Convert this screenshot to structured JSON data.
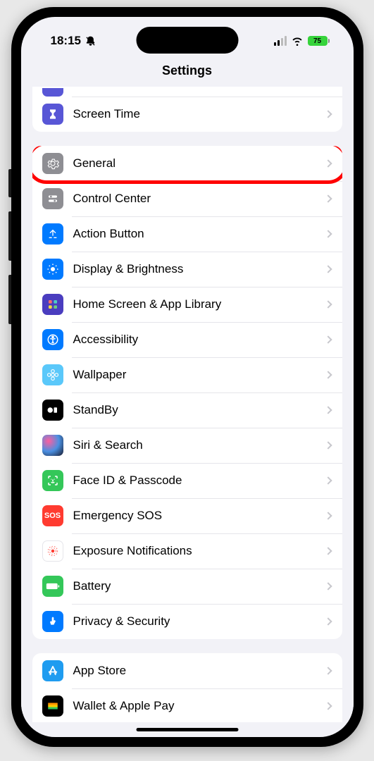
{
  "status": {
    "time": "18:15",
    "battery": "75"
  },
  "header": {
    "title": "Settings"
  },
  "group0": {
    "item0": {
      "label": ""
    },
    "item1": {
      "label": "Screen Time"
    }
  },
  "group1": {
    "item0": {
      "label": "General"
    },
    "item1": {
      "label": "Control Center"
    },
    "item2": {
      "label": "Action Button"
    },
    "item3": {
      "label": "Display & Brightness"
    },
    "item4": {
      "label": "Home Screen & App Library"
    },
    "item5": {
      "label": "Accessibility"
    },
    "item6": {
      "label": "Wallpaper"
    },
    "item7": {
      "label": "StandBy"
    },
    "item8": {
      "label": "Siri & Search"
    },
    "item9": {
      "label": "Face ID & Passcode"
    },
    "item10": {
      "label": "Emergency SOS"
    },
    "item11": {
      "label": "Exposure Notifications"
    },
    "item12": {
      "label": "Battery"
    },
    "item13": {
      "label": "Privacy & Security"
    }
  },
  "group2": {
    "item0": {
      "label": "App Store"
    },
    "item1": {
      "label": "Wallet & Apple Pay"
    }
  },
  "colors": {
    "purple": "#5856d6",
    "gray": "#8e8e93",
    "blue": "#007aff",
    "blue2": "#1b95e0",
    "teal": "#5ac8fa",
    "black": "#000000",
    "green": "#34c759",
    "red": "#ff3b30",
    "white": "#ffffff"
  }
}
